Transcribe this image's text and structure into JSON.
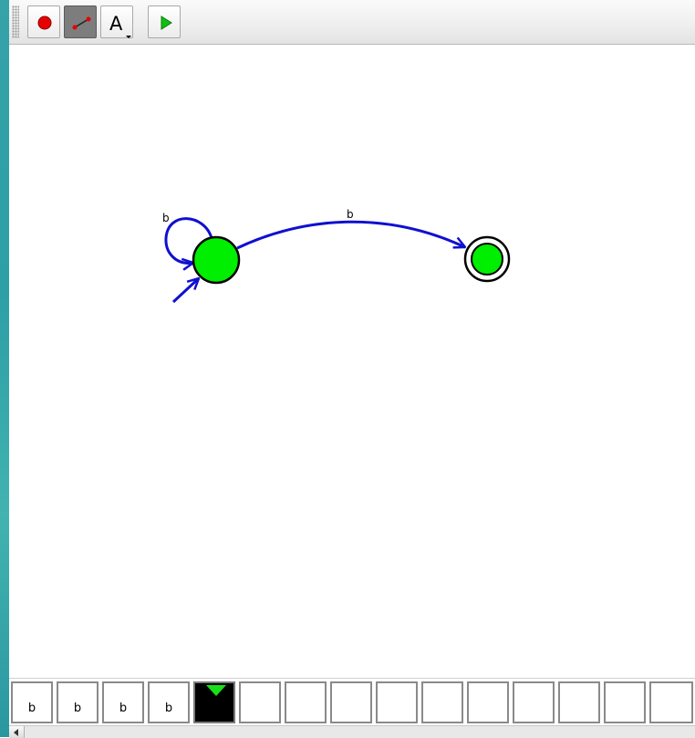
{
  "toolbar": {
    "tools": [
      {
        "name": "state-tool",
        "icon": "red-dot-icon"
      },
      {
        "name": "transition-tool",
        "icon": "edge-icon",
        "selected": true
      },
      {
        "name": "label-tool",
        "icon": "letter-a-icon",
        "label": "A"
      },
      {
        "name": "run-tool",
        "icon": "play-icon"
      }
    ]
  },
  "automaton": {
    "states": [
      {
        "id": "q0",
        "initial": true,
        "accepting": false
      },
      {
        "id": "q1",
        "initial": false,
        "accepting": true
      }
    ],
    "transitions": [
      {
        "from": "q0",
        "to": "q0",
        "label": "b"
      },
      {
        "from": "q0",
        "to": "q1",
        "label": "b"
      }
    ],
    "colors": {
      "state_fill": "#00ee00",
      "edge": "#1010d0",
      "outline": "#000000"
    }
  },
  "tape": {
    "cells": [
      "b",
      "b",
      "b",
      "b",
      "",
      "",
      "",
      "",
      "",
      "",
      "",
      "",
      "",
      "",
      ""
    ],
    "head_index": 4,
    "head_color": "#18e018"
  }
}
